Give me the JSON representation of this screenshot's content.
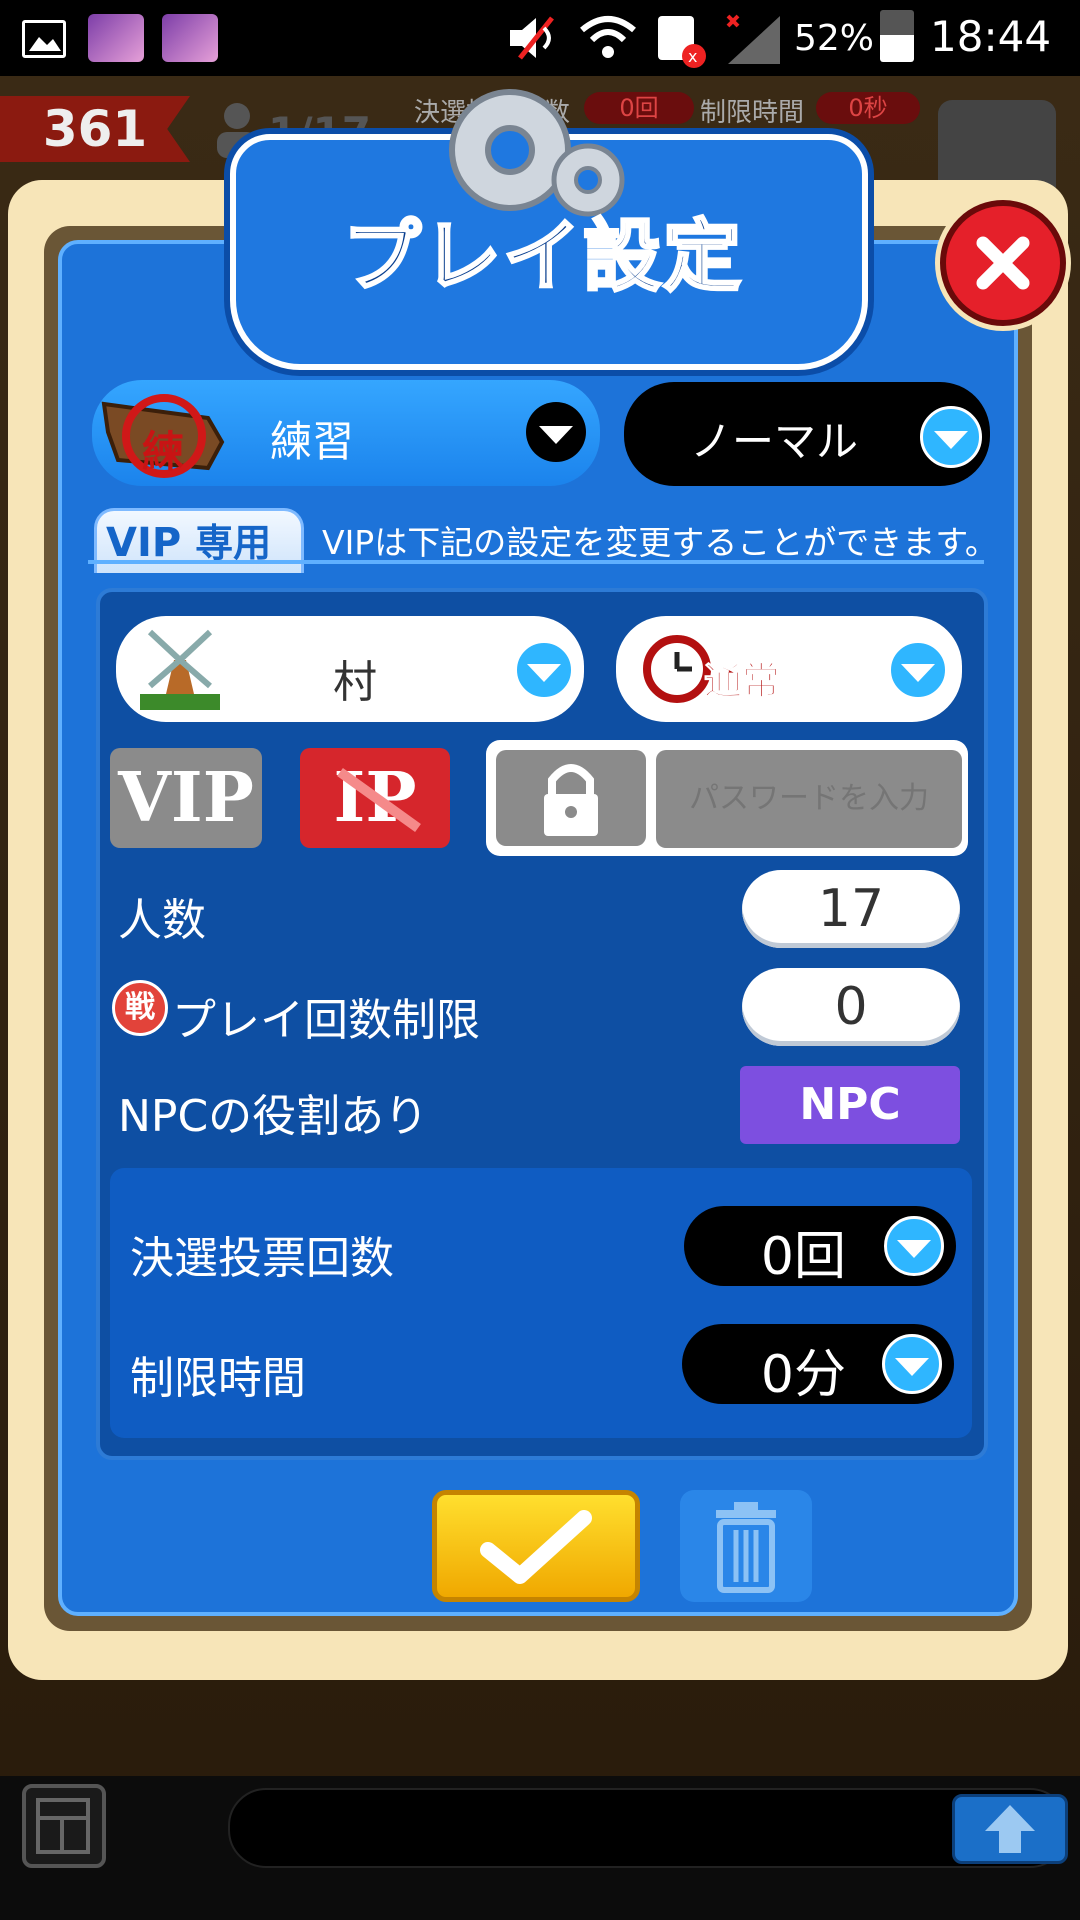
{
  "status_bar": {
    "battery": "52%",
    "time": "18:44"
  },
  "background": {
    "score": "361",
    "players": "1/17",
    "vote_label": "決選投票回数",
    "vote_value": "0回",
    "time_label": "制限時間",
    "time_value": "0秒"
  },
  "dialog": {
    "title": "プレイ設定",
    "mode": {
      "icon_text": "練",
      "label": "練習"
    },
    "difficulty": {
      "label": "ノーマル"
    },
    "vip": {
      "tab_vip": "VIP",
      "tab_label": "専用",
      "note": "VIPは下記の設定を変更することができます。"
    },
    "location": {
      "label": "村"
    },
    "time_setting": {
      "label": "通常"
    },
    "vip_button": "VIP",
    "ip_button": "IP",
    "password": {
      "placeholder": "パスワードを入力"
    },
    "rows": {
      "players": {
        "label": "人数",
        "value": "17"
      },
      "play_limit": {
        "badge": "戦",
        "label": "プレイ回数制限",
        "value": "0"
      },
      "npc": {
        "label": "NPCの役割あり",
        "button": "NPC"
      }
    },
    "final_vote": {
      "label": "決選投票回数",
      "value": "0回"
    },
    "time_limit": {
      "label": "制限時間",
      "value": "0分"
    }
  }
}
